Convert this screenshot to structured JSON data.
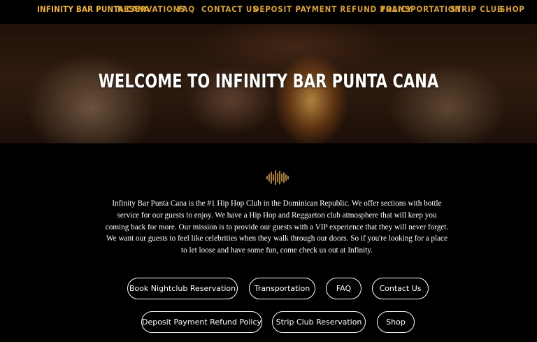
{
  "nav": {
    "brand": "INFINITY BAR PUNTA CANA",
    "items": [
      "RESERVATIONS",
      "FAQ",
      "CONTACT US",
      "DEPOSIT PAYMENT REFUND POLICY",
      "TRANSPORTATION",
      "STRIP CLUB",
      "SHOP"
    ]
  },
  "hero": {
    "title": "WELCOME TO INFINITY BAR PUNTA CANA"
  },
  "content": {
    "icon": "sound-wave-icon",
    "intro": "Infinity Bar Punta Cana is the #1 Hip Hop Club in the Dominican Republic. We offer sections with bottle service for our guests to enjoy. We have a Hip Hop and Reggaeton club atmosphere that will keep you coming back for more. Our mission is to provide our guests with a VIP experience that they will never forget. We want our guests to feel like celebrities when they walk through our doors. So if you're looking for a place to let loose and have some fun, come check us out at Infinity."
  },
  "buttons": {
    "book": "Book Nightclub Reservation",
    "transportation": "Transportation",
    "faq": "FAQ",
    "contact": "Contact Us",
    "deposit": "Deposit Payment Refund Policy",
    "strip": "Strip Club Reservation",
    "shop": "Shop"
  },
  "colors": {
    "accent": "#d9a02b",
    "background": "#000000",
    "text": "#ffffff"
  }
}
